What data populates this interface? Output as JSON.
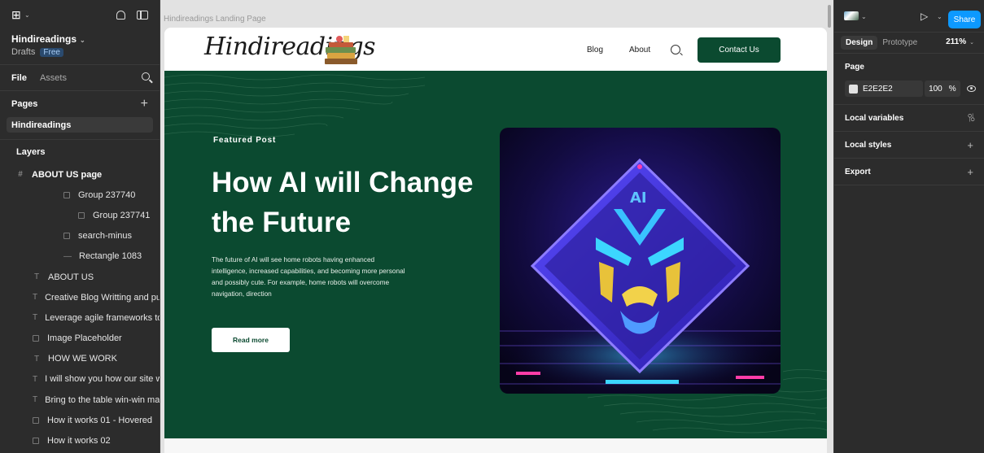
{
  "left_panel": {
    "project_name": "Hindireadings",
    "location": "Drafts",
    "plan_badge": "Free",
    "tabs": [
      "File",
      "Assets"
    ],
    "pages_heading": "Pages",
    "pages": [
      "Hindireadings"
    ],
    "layers_heading": "Layers",
    "layers": [
      {
        "name": "ABOUT US page",
        "type": "frame",
        "indent": 0
      },
      {
        "name": "Group 237740",
        "type": "group",
        "indent": 3
      },
      {
        "name": "Group 237741",
        "type": "group",
        "indent": 4
      },
      {
        "name": "search-minus",
        "type": "group",
        "indent": 3
      },
      {
        "name": "Rectangle 1083",
        "type": "line",
        "indent": 3
      },
      {
        "name": "ABOUT US",
        "type": "text",
        "indent": 1
      },
      {
        "name": "Creative Blog Writting and pu...",
        "type": "text",
        "indent": 1
      },
      {
        "name": "Leverage agile frameworks to ...",
        "type": "text",
        "indent": 1
      },
      {
        "name": "Image Placeholder",
        "type": "group",
        "indent": 1
      },
      {
        "name": "HOW WE WORK",
        "type": "text",
        "indent": 1
      },
      {
        "name": "I will show you how our site w...",
        "type": "text",
        "indent": 1
      },
      {
        "name": "Bring to the table win-win mar...",
        "type": "text",
        "indent": 1
      },
      {
        "name": "How it works 01 - Hovered",
        "type": "group",
        "indent": 1
      },
      {
        "name": "How it works 02",
        "type": "group",
        "indent": 1
      }
    ]
  },
  "canvas": {
    "frame_label": "Hindireadings Landing Page",
    "site": {
      "brand": "Hindireadings",
      "nav_links": [
        "Blog",
        "About"
      ],
      "contact_label": "Contact Us",
      "featured_label": "Featured Post",
      "headline": "How AI will Change the Future",
      "description": "The future of AI will see home robots having enhanced intelligence, increased capabilities, and becoming more personal and possibly cute. For example, home robots will overcome navigation, direction",
      "read_more_label": "Read more",
      "hero_image_text": "AI",
      "primary_color": "#0b4a30"
    }
  },
  "right_panel": {
    "share_label": "Share",
    "tabs": [
      "Design",
      "Prototype"
    ],
    "zoom": "211%",
    "page_heading": "Page",
    "page_fill": "E2E2E2",
    "page_opacity": "100",
    "opacity_unit": "%",
    "sections": [
      "Local variables",
      "Local styles",
      "Export"
    ],
    "accent_color": "#0d99ff"
  }
}
